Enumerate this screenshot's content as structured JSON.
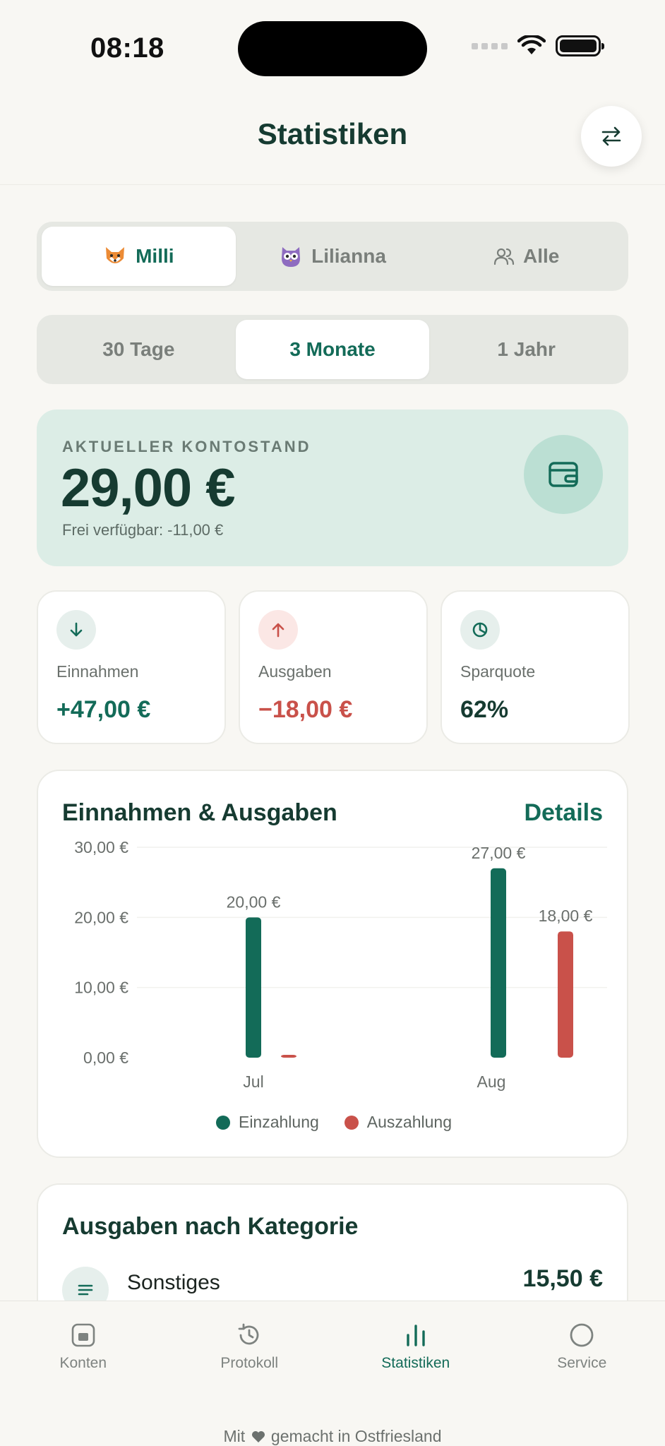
{
  "status_bar": {
    "time": "08:18"
  },
  "header": {
    "title": "Statistiken",
    "swap_icon": "swap-arrows-icon"
  },
  "profiles": {
    "items": [
      {
        "label": "Milli",
        "icon": "fox-icon",
        "active": true
      },
      {
        "label": "Lilianna",
        "icon": "owl-icon",
        "active": false
      },
      {
        "label": "Alle",
        "icon": "users-icon",
        "active": false
      }
    ]
  },
  "range": {
    "items": [
      {
        "label": "30 Tage",
        "active": false
      },
      {
        "label": "3 Monate",
        "active": true
      },
      {
        "label": "1 Jahr",
        "active": false
      }
    ]
  },
  "balance": {
    "label": "AKTUELLER KONTOSTAND",
    "value": "29,00 €",
    "available": "Frei verfügbar: -11,00 €",
    "icon": "wallet-icon"
  },
  "stats": [
    {
      "label": "Einnahmen",
      "value": "+47,00 €",
      "icon": "arrow-down-icon",
      "color": "#136b58",
      "bg": "#e6efec"
    },
    {
      "label": "Ausgaben",
      "value": "−18,00 €",
      "icon": "arrow-up-icon",
      "color": "#c9514a",
      "bg": "#fbe7e5"
    },
    {
      "label": "Sparquote",
      "value": "62%",
      "icon": "pie-chart-icon",
      "color": "#163b31",
      "bg": "#e6efec"
    }
  ],
  "chart": {
    "title": "Einnahmen & Ausgaben",
    "details_label": "Details"
  },
  "chart_data": {
    "type": "bar",
    "categories": [
      "Jul",
      "Aug"
    ],
    "series": [
      {
        "name": "Einzahlung",
        "values": [
          20,
          27
        ],
        "value_labels": [
          "20,00 €",
          "27,00 €"
        ],
        "color": "#136b58"
      },
      {
        "name": "Auszahlung",
        "values": [
          0,
          18
        ],
        "value_labels": [
          "",
          "18,00 €"
        ],
        "color": "#c9514a"
      }
    ],
    "yticks": [
      0,
      10,
      20,
      30
    ],
    "ytick_labels": [
      "0,00 €",
      "10,00 €",
      "20,00 €",
      "30,00 €"
    ],
    "ylim": [
      0,
      30
    ],
    "legend_position": "bottom-center",
    "grid": true
  },
  "categories_card": {
    "title": "Ausgaben nach Kategorie",
    "rows": [
      {
        "name": "Sonstiges",
        "amount": "15,50 €",
        "icon": "lines-icon"
      }
    ]
  },
  "tabbar": {
    "items": [
      {
        "label": "Konten",
        "icon": "account-icon",
        "active": false
      },
      {
        "label": "Protokoll",
        "icon": "history-icon",
        "active": false
      },
      {
        "label": "Statistiken",
        "icon": "bar-chart-icon",
        "active": true
      },
      {
        "label": "Service",
        "icon": "circle-icon",
        "active": false
      }
    ],
    "footer_before": "Mit",
    "footer_after": "gemacht in Ostfriesland",
    "footer_icon": "heart-icon"
  }
}
